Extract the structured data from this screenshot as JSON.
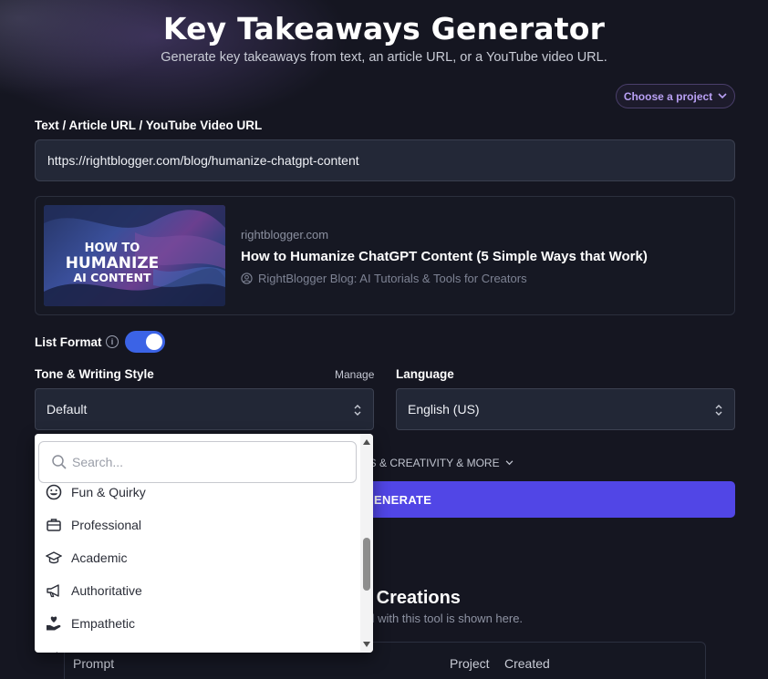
{
  "header": {
    "title": "Key Takeaways Generator",
    "subtitle": "Generate key takeaways from text, an article URL, or a YouTube video URL."
  },
  "project_select": {
    "label": "Choose a project"
  },
  "input_section": {
    "label": "Text / Article URL / YouTube Video URL",
    "value": "https://rightblogger.com/blog/humanize-chatgpt-content"
  },
  "preview": {
    "thumbnail_text": [
      "HOW TO",
      "HUMANIZE",
      "AI CONTENT"
    ],
    "domain": "rightblogger.com",
    "title": "How to Humanize ChatGPT Content (5 Simple Ways that Work)",
    "source": "RightBlogger Blog: AI Tutorials & Tools for Creators"
  },
  "list_format": {
    "label": "List Format",
    "enabled": true
  },
  "tone": {
    "label": "Tone & Writing Style",
    "manage_label": "Manage",
    "selected": "Default",
    "search_placeholder": "Search...",
    "options": [
      {
        "label": "Fun & Quirky",
        "icon": "smiley-icon"
      },
      {
        "label": "Professional",
        "icon": "briefcase-icon"
      },
      {
        "label": "Academic",
        "icon": "graduation-cap-icon"
      },
      {
        "label": "Authoritative",
        "icon": "megaphone-icon"
      },
      {
        "label": "Empathetic",
        "icon": "heart-hand-icon"
      }
    ]
  },
  "language": {
    "label": "Language",
    "selected": "English (US)"
  },
  "more_options": {
    "label": "NS & CREATIVITY & MORE"
  },
  "generate": {
    "label": "ENERATE"
  },
  "creations": {
    "title": "s Creations",
    "subtitle": "ed with this tool is shown here.",
    "columns": [
      "Prompt",
      "Project",
      "Created"
    ]
  },
  "colors": {
    "background": "#151621",
    "accent": "#5146e6",
    "toggle": "#3b63e6",
    "project_text": "#b9a0f4"
  }
}
